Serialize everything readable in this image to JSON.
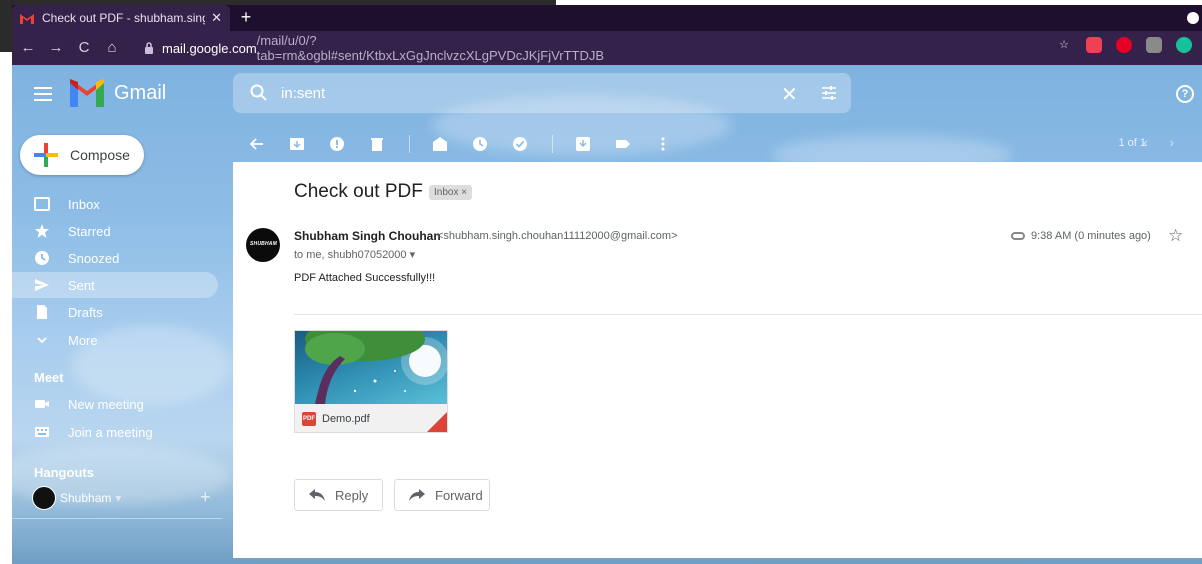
{
  "browser": {
    "tab_title": "Check out PDF - shubham.singh.",
    "tab_close": "✕",
    "new_tab": "+",
    "url_host": "mail.google.com",
    "url_path": "/mail/u/0/?tab=rm&ogbl#sent/KtbxLxGgJnclvzcXLgPVDcJKjFjVrTTDJB"
  },
  "gmail": {
    "brand": "Gmail",
    "search_value": "in:sent",
    "help_glyph": "?",
    "compose_label": "Compose"
  },
  "sidebar": {
    "items": [
      {
        "label": "Inbox"
      },
      {
        "label": "Starred"
      },
      {
        "label": "Snoozed"
      },
      {
        "label": "Sent"
      },
      {
        "label": "Drafts"
      },
      {
        "label": "More"
      }
    ],
    "meet_heading": "Meet",
    "meet_items": [
      {
        "label": "New meeting"
      },
      {
        "label": "Join a meeting"
      }
    ],
    "hangouts_heading": "Hangouts",
    "hangouts_user": "Shubham",
    "hangouts_dropdown": "▾",
    "hangouts_add": "+"
  },
  "toolbar": {
    "pager": "1 of 1",
    "pager_arrows": "‹›"
  },
  "message": {
    "subject": "Check out PDF",
    "label_chip": "Inbox ×",
    "sender_name": "Shubham Singh Chouhan",
    "sender_email": "<shubham.singh.chouhan11112000@gmail.com>",
    "to_line": "to me, shubh07052000 ▾",
    "time": "9:38 AM (0 minutes ago)",
    "body": "PDF Attached Successfully!!!",
    "attachment_name": "Demo.pdf",
    "pdf_badge": "PDF",
    "avatar_brand": "SHUBHAM",
    "reply_label": "Reply",
    "forward_label": "Forward"
  },
  "colors": {
    "browser_dark": "#35224a",
    "tab_strip": "#1f0f2e",
    "pdf_red": "#db4437"
  }
}
